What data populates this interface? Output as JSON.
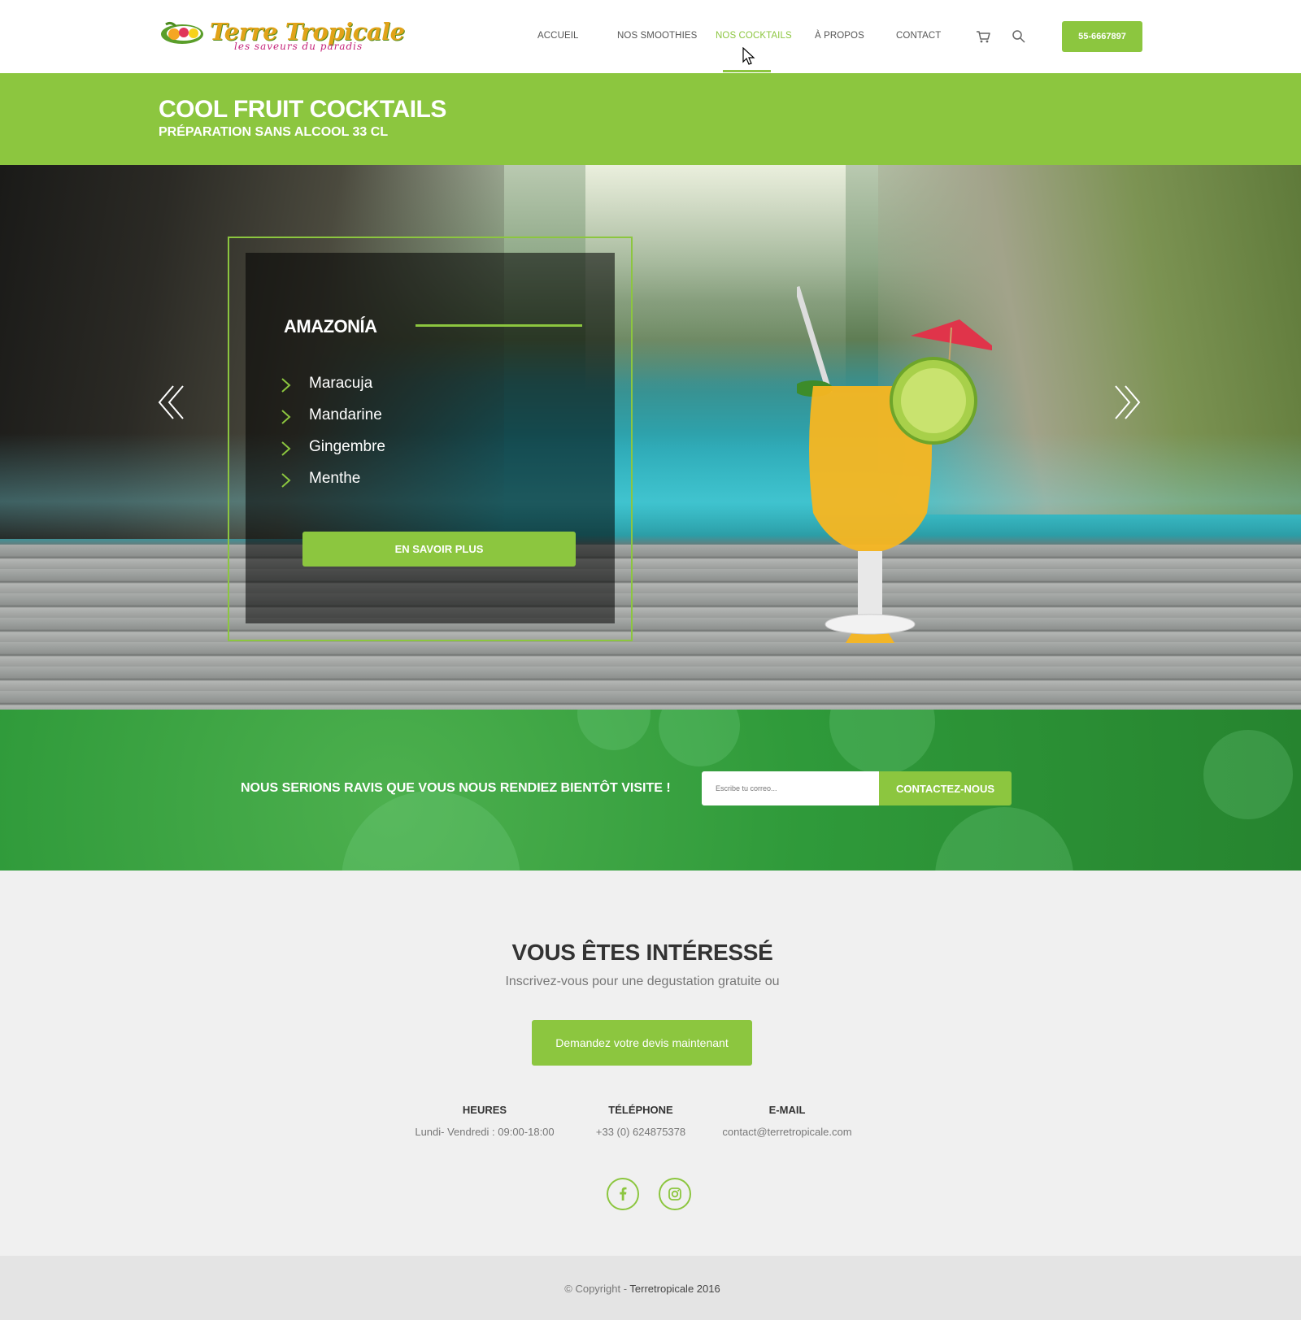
{
  "brand": {
    "name": "Terre Tropicale",
    "tagline": "les saveurs du paradis"
  },
  "nav": {
    "items": [
      {
        "label": "ACCUEIL"
      },
      {
        "label": "NOS SMOOTHIES"
      },
      {
        "label": "NOS COCKTAILS"
      },
      {
        "label": "À PROPOS"
      },
      {
        "label": "CONTACT"
      }
    ],
    "active": "NOS COCKTAILS",
    "phone": "55-6667897",
    "icons": [
      "cart-icon",
      "search-icon"
    ]
  },
  "banner": {
    "title": "COOL FRUIT COCKTAILS",
    "subtitle": "PRÉPARATION SANS ALCOOL 33 CL"
  },
  "slide": {
    "name": "AMAZONÍA",
    "ingredients": [
      "Maracuja",
      "Mandarine",
      "Gingembre",
      "Menthe"
    ],
    "button": "EN SAVOIR PLUS"
  },
  "contact_band": {
    "text": "NOUS SERIONS RAVIS QUE VOUS NOUS RENDIEZ BIENTÔT VISITE !",
    "email_placeholder": "Escribe tu correo...",
    "button": "CONTACTEZ-NOUS"
  },
  "interested": {
    "title": "VOUS ÊTES INTÉRESSÉ",
    "subtitle": "Inscrivez-vous pour une degustation gratuite ou",
    "button": "Demandez votre devis maintenant",
    "info": [
      {
        "heading": "HEURES",
        "value": "Lundi- Vendredi : 09:00-18:00"
      },
      {
        "heading": "TÉLÉPHONE",
        "value": "+33 (0) 624875378"
      },
      {
        "heading": "E-MAIL",
        "value": "contact@terretropicale.com"
      }
    ],
    "social": [
      "facebook-icon",
      "instagram-icon"
    ]
  },
  "footer": {
    "prefix": "© Copyright - ",
    "brand": "Terretropicale 2016"
  },
  "colors": {
    "accent": "#8cc63f",
    "band_green": "#2f9a3a",
    "footer_bg": "#e4e4e4"
  }
}
